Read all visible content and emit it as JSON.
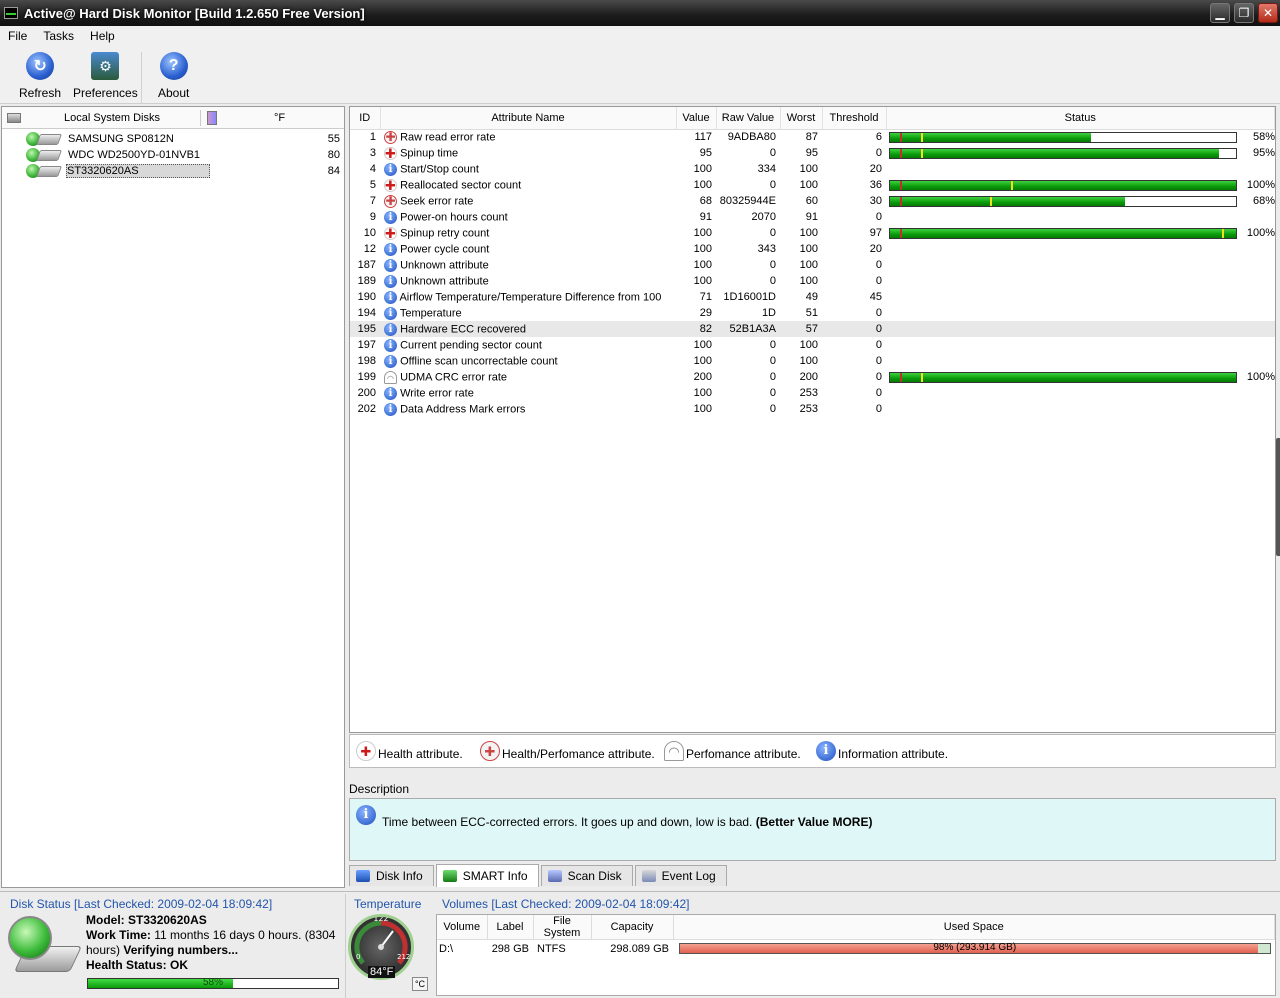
{
  "window": {
    "title": "Active@ Hard Disk Monitor [Build 1.2.650 Free Version]"
  },
  "menu": [
    "File",
    "Tasks",
    "Help"
  ],
  "toolbar": {
    "refresh": "Refresh",
    "preferences": "Preferences",
    "about": "About"
  },
  "disks": {
    "header": "Local System Disks",
    "unit": "°F",
    "items": [
      {
        "name": "SAMSUNG SP0812N",
        "temp": "55"
      },
      {
        "name": "WDC WD2500YD-01NVB1",
        "temp": "80"
      },
      {
        "name": "ST3320620AS",
        "temp": "84"
      }
    ]
  },
  "smart": {
    "columns": {
      "id": "ID",
      "name": "Attribute Name",
      "value": "Value",
      "raw": "Raw Value",
      "worst": "Worst",
      "threshold": "Threshold",
      "status": "Status"
    },
    "rows": [
      {
        "id": "1",
        "type": "hp",
        "name": "Raw read error rate",
        "value": "117",
        "raw": "9ADBA80",
        "worst": "87",
        "threshold": "6",
        "pct": 58,
        "marker": 0.09,
        "status": "58%"
      },
      {
        "id": "3",
        "type": "health",
        "name": "Spinup time",
        "value": "95",
        "raw": "0",
        "worst": "95",
        "threshold": "0",
        "pct": 95,
        "marker": 0.09,
        "status": "95%"
      },
      {
        "id": "4",
        "type": "info",
        "name": "Start/Stop count",
        "value": "100",
        "raw": "334",
        "worst": "100",
        "threshold": "20"
      },
      {
        "id": "5",
        "type": "health",
        "name": "Reallocated sector count",
        "value": "100",
        "raw": "0",
        "worst": "100",
        "threshold": "36",
        "pct": 100,
        "marker": 0.35,
        "status": "100%"
      },
      {
        "id": "7",
        "type": "hp",
        "name": "Seek error rate",
        "value": "68",
        "raw": "80325944E",
        "worst": "60",
        "threshold": "30",
        "pct": 68,
        "marker": 0.29,
        "status": "68%"
      },
      {
        "id": "9",
        "type": "info",
        "name": "Power-on hours count",
        "value": "91",
        "raw": "2070",
        "worst": "91",
        "threshold": "0"
      },
      {
        "id": "10",
        "type": "health",
        "name": "Spinup retry count",
        "value": "100",
        "raw": "0",
        "worst": "100",
        "threshold": "97",
        "pct": 100,
        "marker": 0.96,
        "status": "100%"
      },
      {
        "id": "12",
        "type": "info",
        "name": "Power cycle count",
        "value": "100",
        "raw": "343",
        "worst": "100",
        "threshold": "20"
      },
      {
        "id": "187",
        "type": "info",
        "name": "Unknown attribute",
        "value": "100",
        "raw": "0",
        "worst": "100",
        "threshold": "0"
      },
      {
        "id": "189",
        "type": "info",
        "name": "Unknown attribute",
        "value": "100",
        "raw": "0",
        "worst": "100",
        "threshold": "0"
      },
      {
        "id": "190",
        "type": "info",
        "name": "Airflow Temperature/Temperature Difference from 100",
        "value": "71",
        "raw": "1D16001D",
        "worst": "49",
        "threshold": "45"
      },
      {
        "id": "194",
        "type": "info",
        "name": "Temperature",
        "value": "29",
        "raw": "1D",
        "worst": "51",
        "threshold": "0"
      },
      {
        "id": "195",
        "type": "info",
        "name": "Hardware ECC recovered",
        "value": "82",
        "raw": "52B1A3A",
        "worst": "57",
        "threshold": "0",
        "selected": true
      },
      {
        "id": "197",
        "type": "info",
        "name": "Current pending sector count",
        "value": "100",
        "raw": "0",
        "worst": "100",
        "threshold": "0"
      },
      {
        "id": "198",
        "type": "info",
        "name": "Offline scan uncorrectable count",
        "value": "100",
        "raw": "0",
        "worst": "100",
        "threshold": "0"
      },
      {
        "id": "199",
        "type": "perf",
        "name": "UDMA CRC error rate",
        "value": "200",
        "raw": "0",
        "worst": "200",
        "threshold": "0",
        "pct": 100,
        "marker": 0.09,
        "status": "100%"
      },
      {
        "id": "200",
        "type": "info",
        "name": "Write error rate",
        "value": "100",
        "raw": "0",
        "worst": "253",
        "threshold": "0"
      },
      {
        "id": "202",
        "type": "info",
        "name": "Data Address Mark errors",
        "value": "100",
        "raw": "0",
        "worst": "253",
        "threshold": "0"
      }
    ]
  },
  "legend": {
    "health": "Health attribute.",
    "hp": "Health/Perfomance attribute.",
    "perf": "Perfomance attribute.",
    "info": "Information attribute."
  },
  "description": {
    "label": "Description",
    "text": "Time between ECC-corrected errors. It goes up and down, low is bad.",
    "hint": "(Better Value MORE)"
  },
  "tabs": [
    "Disk Info",
    "SMART Info",
    "Scan Disk",
    "Event Log"
  ],
  "disk_status": {
    "title": "Disk Status [Last Checked: 2009-02-04 18:09:42]",
    "model_label": "Model:",
    "model": "ST3320620AS",
    "work_label": "Work Time:",
    "work": "11 months 16 days 0 hours. (8304 hours)",
    "verifying": "Verifying numbers...",
    "health_label": "Health Status: OK",
    "health_pct": 58,
    "health_text": "58%"
  },
  "temperature": {
    "title": "Temperature",
    "value": "84°F",
    "gauge_top": "122",
    "gauge_left": "0",
    "gauge_right": "212",
    "unit_button": "°C"
  },
  "volumes": {
    "title": "Volumes [Last Checked: 2009-02-04 18:09:42]",
    "columns": {
      "volume": "Volume",
      "label": "Label",
      "fs": "File System",
      "capacity": "Capacity",
      "used": "Used Space"
    },
    "rows": [
      {
        "volume": "D:\\",
        "label": "298 GB",
        "fs": "NTFS",
        "capacity": "298.089 GB",
        "used_pct": 98,
        "used_text": "98% (293.914 GB)"
      }
    ]
  },
  "colors": {
    "accent": "#2255aa",
    "bar_green": "#0a9a0a",
    "marker_red": "#c03030",
    "marker_yellow": "#f0e020",
    "desc_bg": "#e0f7f7"
  }
}
